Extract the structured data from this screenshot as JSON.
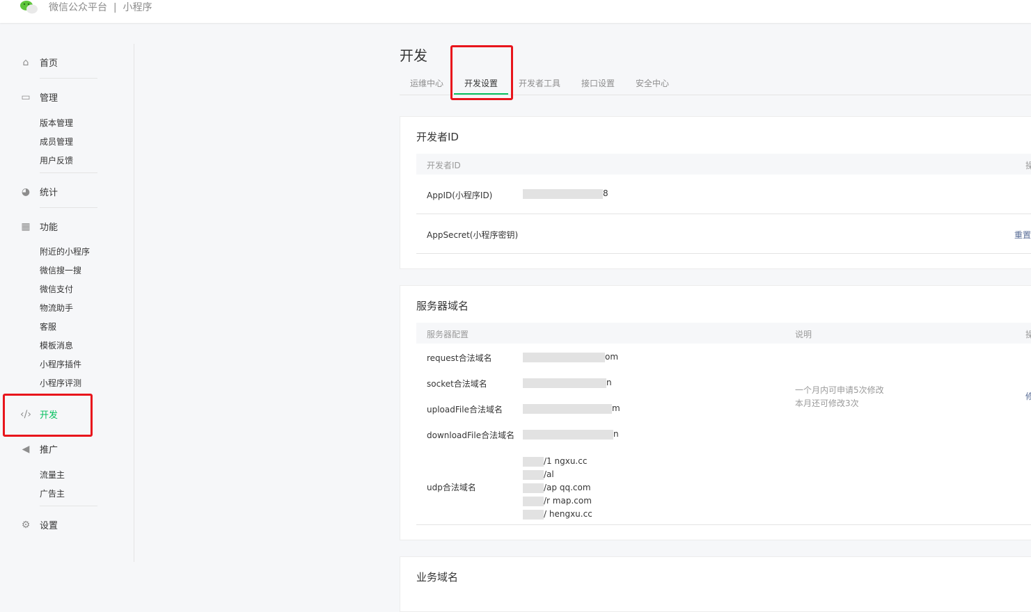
{
  "header": {
    "brand": "微信公众平台",
    "divider": "|",
    "product": "小程序"
  },
  "sidebar": {
    "home": "首页",
    "manage": "管理",
    "manage_items": [
      "版本管理",
      "成员管理",
      "用户反馈"
    ],
    "stats": "统计",
    "features": "功能",
    "feature_items": [
      "附近的小程序",
      "微信搜一搜",
      "微信支付",
      "物流助手",
      "客服",
      "模板消息",
      "小程序插件",
      "小程序评测"
    ],
    "dev": "开发",
    "promo": "推广",
    "promo_items": [
      "流量主",
      "广告主"
    ],
    "settings": "设置"
  },
  "page": {
    "title": "开发",
    "tabs": [
      "运维中心",
      "开发设置",
      "开发者工具",
      "接口设置",
      "安全中心"
    ],
    "active_tab": 1
  },
  "dev_id": {
    "title": "开发者ID",
    "col1": "开发者ID",
    "col_op": "操",
    "appid_label": "AppID(小程序ID)",
    "appid_value": "8",
    "secret_label": "AppSecret(小程序密钥)",
    "reset": "重置"
  },
  "server": {
    "title": "服务器域名",
    "col1": "服务器配置",
    "col2": "说明",
    "col_op": "操",
    "rows": [
      {
        "label": "request合法域名",
        "value": "om"
      },
      {
        "label": "socket合法域名",
        "value": "n"
      },
      {
        "label": "uploadFile合法域名",
        "value": "m"
      },
      {
        "label": "downloadFile合法域名",
        "value": "n"
      }
    ],
    "udp_label": "udp合法域名",
    "udp_values": [
      "/1 ngxu.cc",
      "/al",
      "/ap qq.com",
      "/r map.com",
      "/ hengxu.cc"
    ],
    "note1": "一个月内可申请5次修改",
    "note2": "本月还可修改3次",
    "modify": "修"
  },
  "biz": {
    "title": "业务域名"
  },
  "colors": {
    "accent": "#07c160",
    "highlight": "#e8151c"
  }
}
